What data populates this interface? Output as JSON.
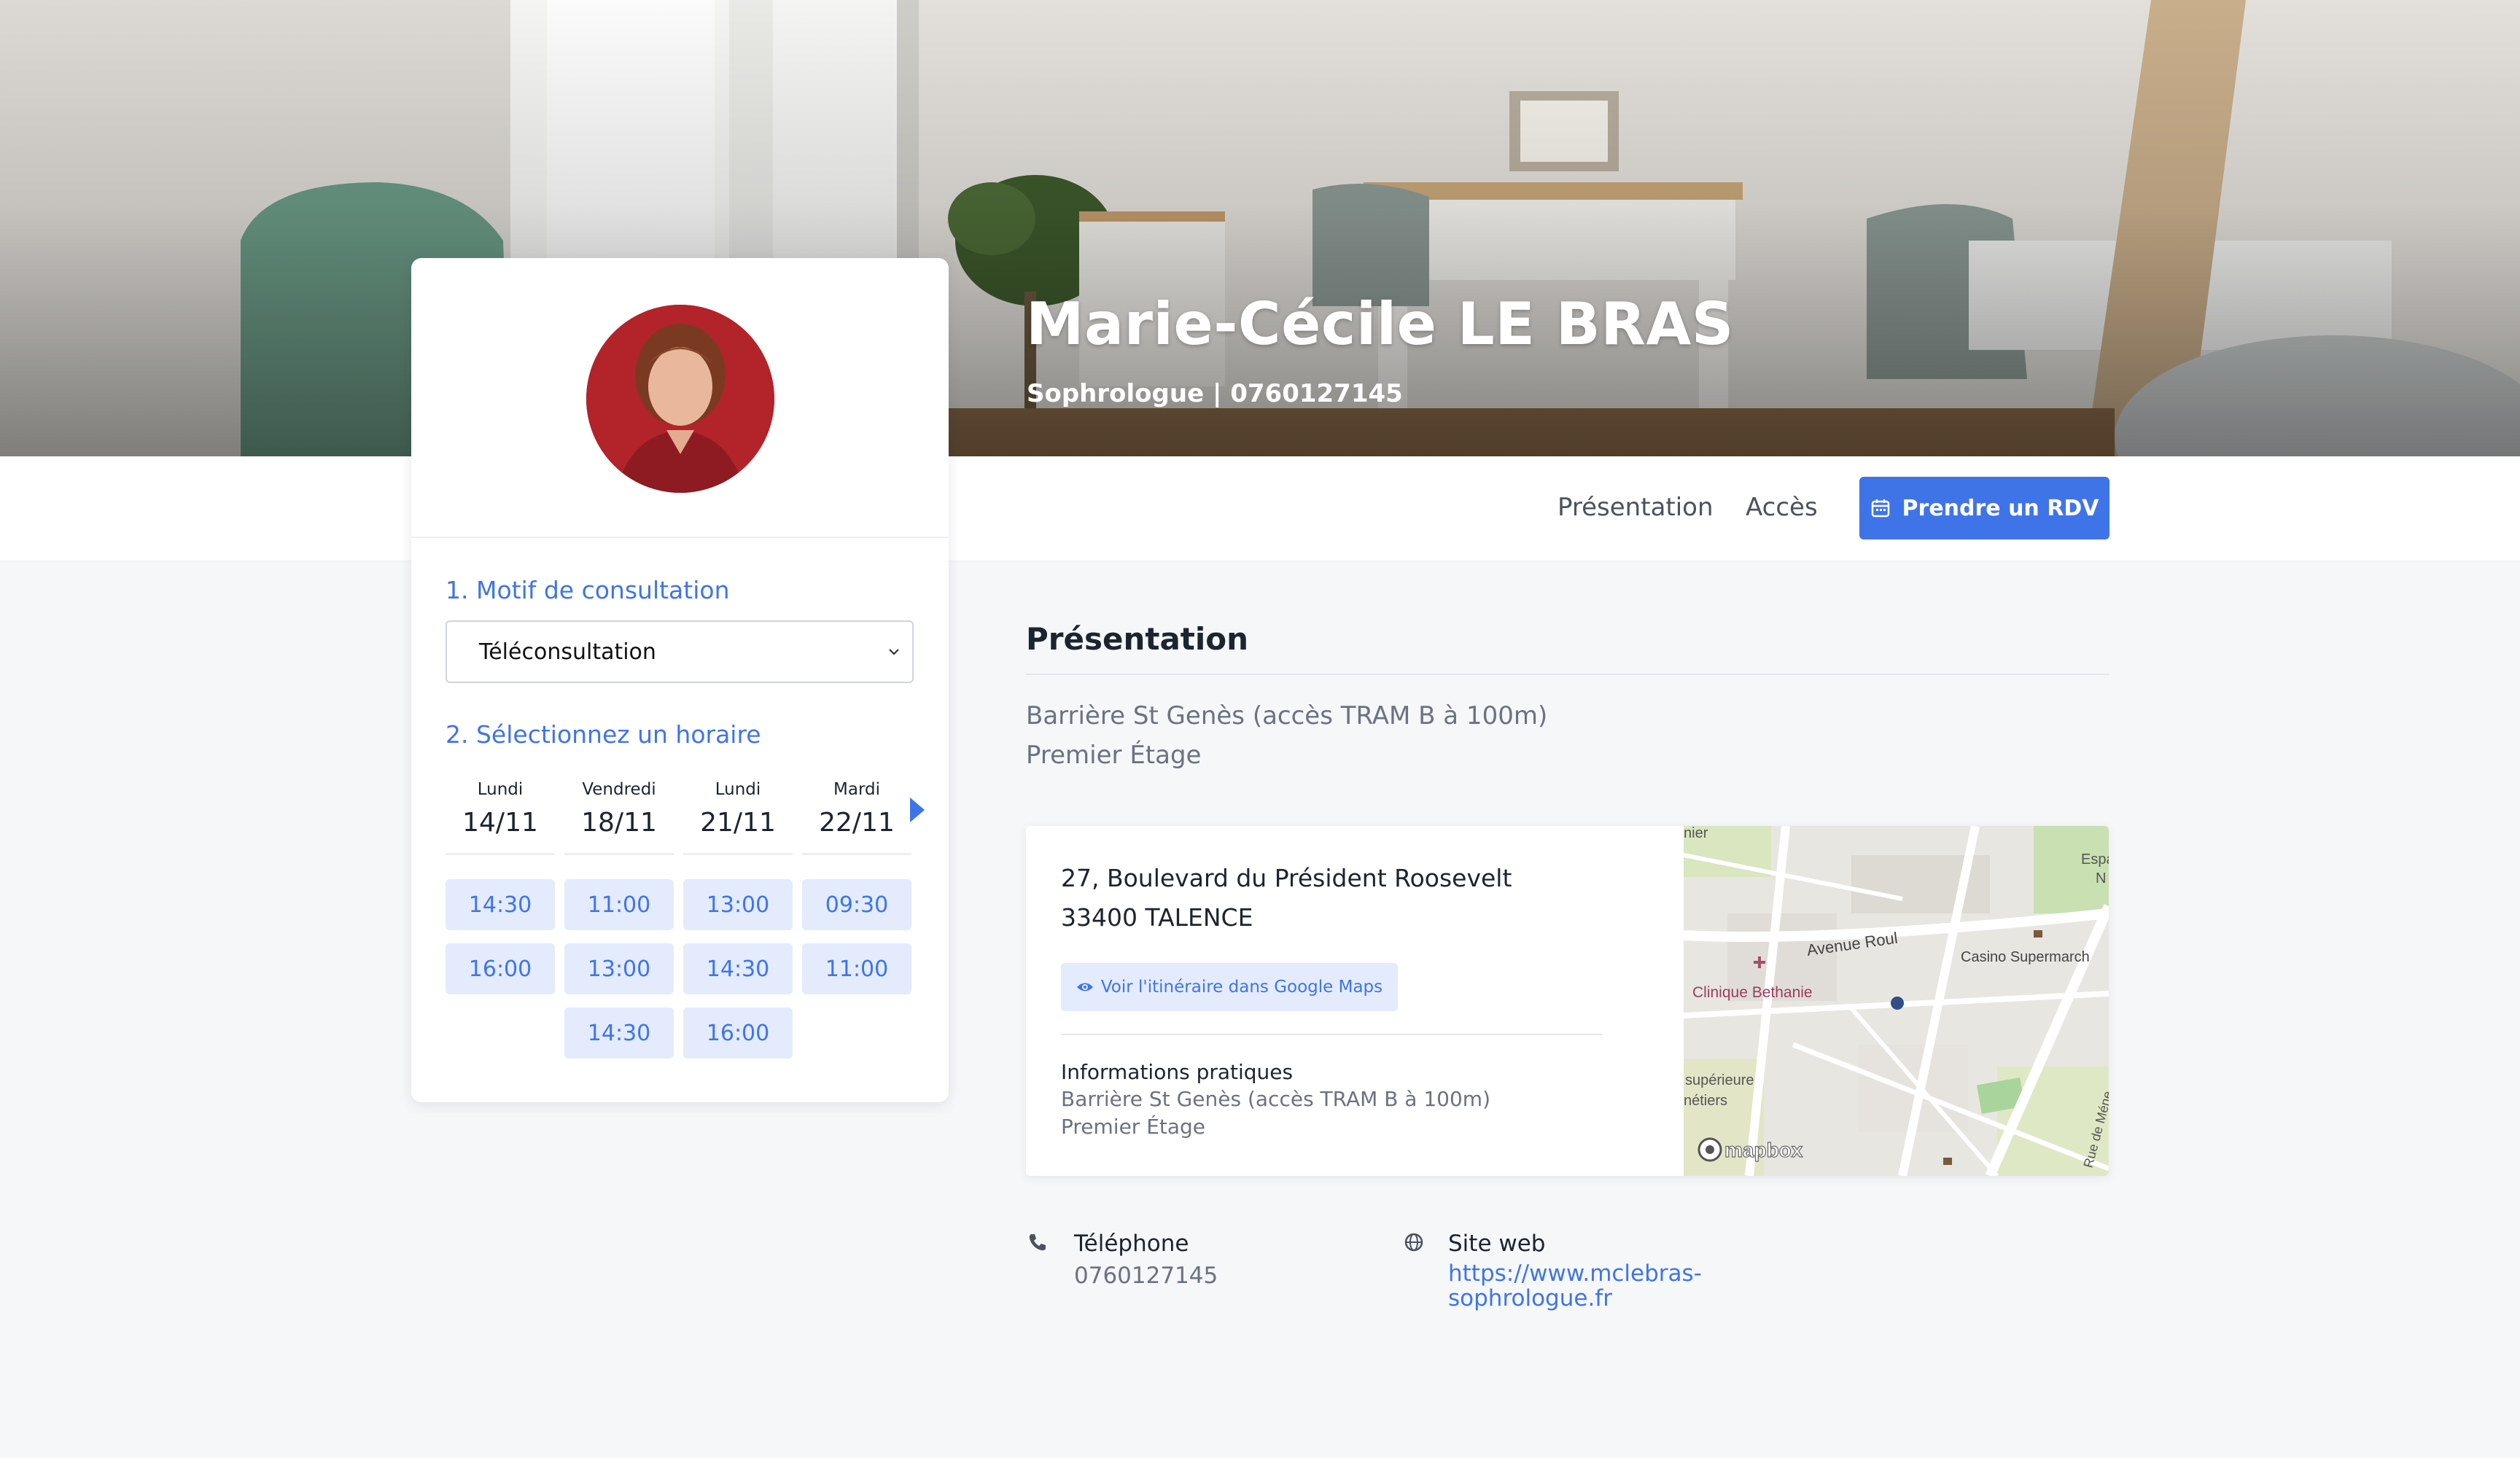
{
  "header": {
    "name": "Marie-Cécile LE BRAS",
    "subtitle": "Sophrologue | 0760127145"
  },
  "nav": {
    "links": [
      "Présentation",
      "Accès"
    ],
    "cta_label": "Prendre un RDV"
  },
  "booking": {
    "step1_title": "1. Motif de consultation",
    "motif_selected": "Téléconsultation",
    "step2_title": "2. Sélectionnez un horaire",
    "days": [
      {
        "name": "Lundi",
        "date": "14/11",
        "slots": [
          "14:30",
          "16:00"
        ]
      },
      {
        "name": "Vendredi",
        "date": "18/11",
        "slots": [
          "11:00",
          "13:00",
          "14:30"
        ]
      },
      {
        "name": "Lundi",
        "date": "21/11",
        "slots": [
          "13:00",
          "14:30",
          "16:00"
        ]
      },
      {
        "name": "Mardi",
        "date": "22/11",
        "slots": [
          "09:30",
          "11:00"
        ]
      }
    ]
  },
  "presentation": {
    "title": "Présentation",
    "lines": [
      "Barrière St Genès (accès TRAM B à 100m)",
      "Premier Étage"
    ]
  },
  "address": {
    "line1": "27, Boulevard du Président Roosevelt",
    "line2": "33400 TALENCE",
    "maps_button": "Voir l'itinéraire dans Google Maps",
    "info_title": "Informations pratiques",
    "info_lines": [
      "Barrière St Genès (accès TRAM B à 100m)",
      "Premier Étage"
    ]
  },
  "map_labels": {
    "top_left": "nier",
    "top_right": "Espa",
    "top_right2": "N",
    "avenue": "Avenue Roul",
    "casino": "Casino Supermarch",
    "clinique": "Clinique Bethanie",
    "superieure": "supérieure",
    "metiers": "nétiers",
    "rue": "Rue de Méne",
    "logo": "mapbox"
  },
  "contact": {
    "phone_label": "Téléphone",
    "phone_value": "0760127145",
    "web_label": "Site web",
    "web_value": "https://www.mclebras-sophrologue.fr",
    "web_line1": "https://www.mclebras-",
    "web_line2": "sophrologue.fr"
  },
  "colors": {
    "accent": "#3f74e9",
    "slot_bg": "#e3ebfd",
    "page_bg": "#f6f7f9"
  }
}
